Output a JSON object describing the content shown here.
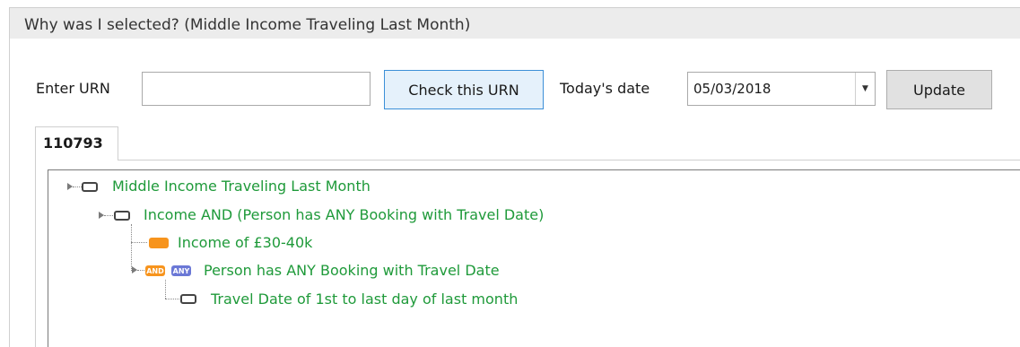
{
  "window": {
    "title": "Why was I selected? (Middle Income Traveling Last Month)"
  },
  "form": {
    "urn_label": "Enter URN",
    "urn_value": "",
    "check_button": "Check this URN",
    "date_label": "Today's date",
    "date_value": "05/03/2018",
    "update_button": "Update"
  },
  "tabs": [
    {
      "label": "110793"
    }
  ],
  "tree": {
    "root": "Middle Income Traveling Last Month",
    "group": "Income AND (Person has ANY Booking with Travel Date)",
    "income": "Income of £30-40k",
    "booking": "Person has ANY Booking with Travel Date",
    "travel_date": "Travel Date of 1st to last day of last month",
    "and_badge": "AND",
    "any_badge": "ANY"
  },
  "colors": {
    "node_text": "#1f9a3a",
    "orange": "#f7941d",
    "any_purple": "#6b78d6",
    "button_focus_border": "#3c8fd8"
  }
}
